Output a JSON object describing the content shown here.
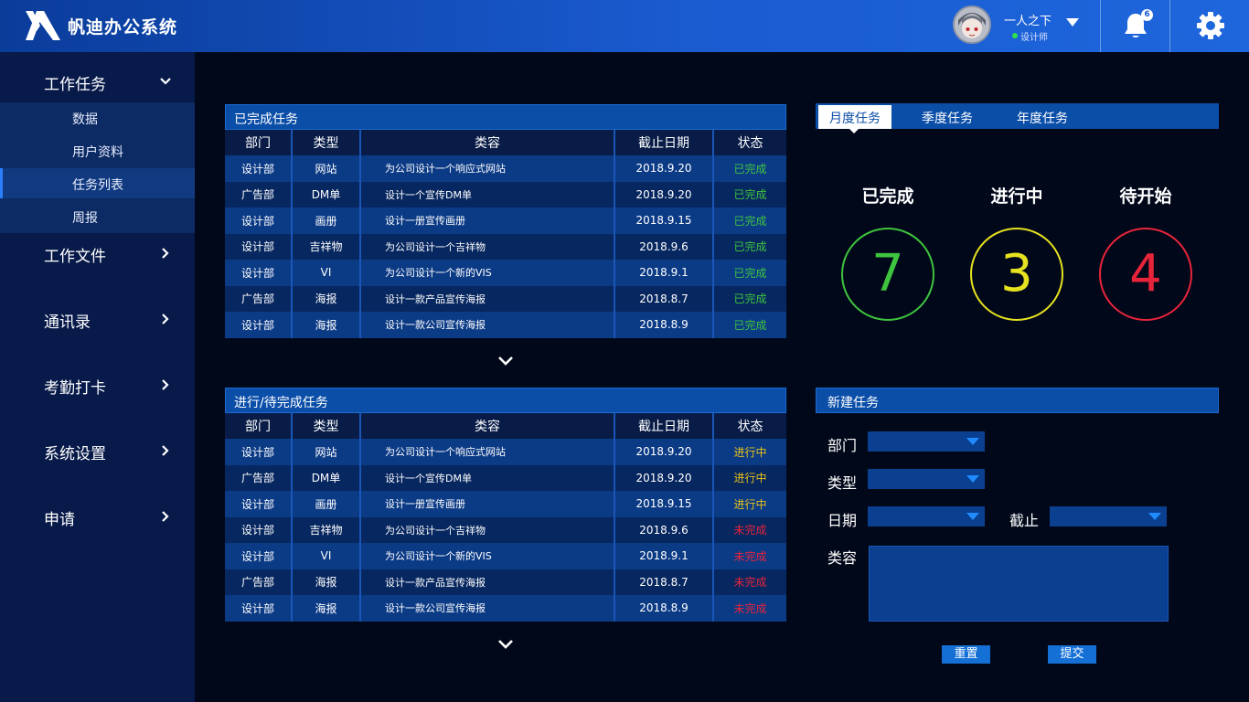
{
  "header": {
    "app_title": "帆迪办公系统",
    "user_name": "一人之下",
    "user_role": "设计师",
    "notification_count": "6"
  },
  "sidebar": {
    "items": [
      {
        "label": "工作任务",
        "expanded": true
      },
      {
        "label": "工作文件"
      },
      {
        "label": "通讯录"
      },
      {
        "label": "考勤打卡"
      },
      {
        "label": "系统设置"
      },
      {
        "label": "申请"
      }
    ],
    "sub_items": [
      {
        "label": "数据"
      },
      {
        "label": "用户资料"
      },
      {
        "label": "任务列表",
        "active": true
      },
      {
        "label": "周报"
      }
    ]
  },
  "completed_tasks": {
    "title": "已完成任务",
    "columns": [
      "部门",
      "类型",
      "类容",
      "截止日期",
      "状态"
    ],
    "rows": [
      {
        "dept": "设计部",
        "type": "网站",
        "desc": "为公司设计一个响应式网站",
        "date": "2018.9.20",
        "status": "已完成"
      },
      {
        "dept": "广告部",
        "type": "DM单",
        "desc": "设计一个宣传DM单",
        "date": "2018.9.20",
        "status": "已完成"
      },
      {
        "dept": "设计部",
        "type": "画册",
        "desc": "设计一册宣传画册",
        "date": "2018.9.15",
        "status": "已完成"
      },
      {
        "dept": "设计部",
        "type": "吉祥物",
        "desc": "为公司设计一个吉祥物",
        "date": "2018.9.6",
        "status": "已完成"
      },
      {
        "dept": "设计部",
        "type": "VI",
        "desc": "为公司设计一个新的VIS",
        "date": "2018.9.1",
        "status": "已完成"
      },
      {
        "dept": "广告部",
        "type": "海报",
        "desc": "设计一款产品宣传海报",
        "date": "2018.8.7",
        "status": "已完成"
      },
      {
        "dept": "设计部",
        "type": "海报",
        "desc": "设计一款公司宣传海报",
        "date": "2018.8.9",
        "status": "已完成"
      }
    ]
  },
  "pending_tasks": {
    "title": "进行/待完成任务",
    "columns": [
      "部门",
      "类型",
      "类容",
      "截止日期",
      "状态"
    ],
    "rows": [
      {
        "dept": "设计部",
        "type": "网站",
        "desc": "为公司设计一个响应式网站",
        "date": "2018.9.20",
        "status": "进行中"
      },
      {
        "dept": "广告部",
        "type": "DM单",
        "desc": "设计一个宣传DM单",
        "date": "2018.9.20",
        "status": "进行中"
      },
      {
        "dept": "设计部",
        "type": "画册",
        "desc": "设计一册宣传画册",
        "date": "2018.9.15",
        "status": "进行中"
      },
      {
        "dept": "设计部",
        "type": "吉祥物",
        "desc": "为公司设计一个吉祥物",
        "date": "2018.9.6",
        "status": "未完成"
      },
      {
        "dept": "设计部",
        "type": "VI",
        "desc": "为公司设计一个新的VIS",
        "date": "2018.9.1",
        "status": "未完成"
      },
      {
        "dept": "广告部",
        "type": "海报",
        "desc": "设计一款产品宣传海报",
        "date": "2018.8.7",
        "status": "未完成"
      },
      {
        "dept": "设计部",
        "type": "海报",
        "desc": "设计一款公司宣传海报",
        "date": "2018.8.9",
        "status": "未完成"
      }
    ]
  },
  "stats": {
    "tabs": [
      {
        "label": "月度任务",
        "active": true
      },
      {
        "label": "季度任务"
      },
      {
        "label": "年度任务"
      }
    ],
    "items": [
      {
        "label": "已完成",
        "value": "7",
        "color": "#3ec43e"
      },
      {
        "label": "进行中",
        "value": "3",
        "color": "#e6e21f"
      },
      {
        "label": "待开始",
        "value": "4",
        "color": "#e8243a"
      }
    ]
  },
  "new_task": {
    "title": "新建任务",
    "dept_label": "部门",
    "type_label": "型",
    "type_label_prefix": "类",
    "date_label": "日期",
    "deadline_label": "截止",
    "content_label": "类容",
    "reset_label": "重置",
    "submit_label": "提交"
  },
  "colors": {
    "status_done": "#3ec43e",
    "status_doing": "#e6c217",
    "status_todo": "#e8243a",
    "accent": "#1570d6"
  }
}
